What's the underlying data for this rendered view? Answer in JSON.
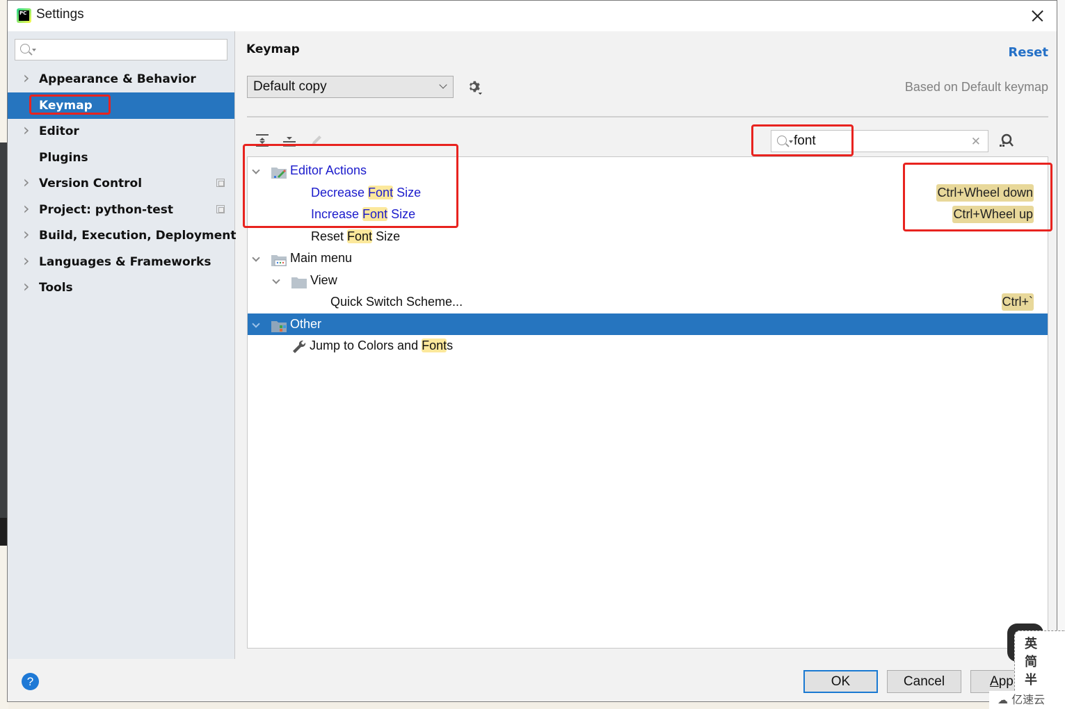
{
  "window": {
    "title": "Settings",
    "app_icon": "pycharm-icon",
    "close_icon": "close-icon"
  },
  "sidebar": {
    "search": {
      "value": "",
      "placeholder": ""
    },
    "items": [
      {
        "label": "Appearance & Behavior",
        "expandable": true,
        "selected": false,
        "project_icon": false
      },
      {
        "label": "Keymap",
        "expandable": false,
        "selected": true,
        "project_icon": false
      },
      {
        "label": "Editor",
        "expandable": true,
        "selected": false,
        "project_icon": false
      },
      {
        "label": "Plugins",
        "expandable": false,
        "selected": false,
        "project_icon": false
      },
      {
        "label": "Version Control",
        "expandable": true,
        "selected": false,
        "project_icon": true
      },
      {
        "label": "Project: python-test",
        "expandable": true,
        "selected": false,
        "project_icon": true
      },
      {
        "label": "Build, Execution, Deployment",
        "expandable": true,
        "selected": false,
        "project_icon": false
      },
      {
        "label": "Languages & Frameworks",
        "expandable": true,
        "selected": false,
        "project_icon": false
      },
      {
        "label": "Tools",
        "expandable": true,
        "selected": false,
        "project_icon": false
      }
    ]
  },
  "main": {
    "title": "Keymap",
    "reset_label": "Reset",
    "keymap_select": {
      "value": "Default copy"
    },
    "based_on": "Based on Default keymap",
    "toolbar": {
      "expand_all_icon": "expand-all-icon",
      "collapse_all_icon": "collapse-all-icon",
      "edit_icon": "pencil-icon"
    },
    "filter": {
      "value": "font",
      "placeholder": ""
    },
    "tree": [
      {
        "level": 0,
        "expanded": true,
        "icon": "editor-actions-folder-icon",
        "parts": [
          "Editor Actions"
        ],
        "highlight": [],
        "color": "blue",
        "shortcut": "",
        "selected": false
      },
      {
        "level": 2,
        "icon": "",
        "parts": [
          "Decrease ",
          "Font",
          " Size"
        ],
        "highlight": [
          1
        ],
        "color": "blue",
        "shortcut": "Ctrl+Wheel down",
        "selected": false
      },
      {
        "level": 2,
        "icon": "",
        "parts": [
          "Increase ",
          "Font",
          " Size"
        ],
        "highlight": [
          1
        ],
        "color": "blue",
        "shortcut": "Ctrl+Wheel up",
        "selected": false
      },
      {
        "level": 2,
        "icon": "",
        "parts": [
          "Reset ",
          "Font",
          " Size"
        ],
        "highlight": [
          1
        ],
        "color": "black",
        "shortcut": "",
        "selected": false
      },
      {
        "level": 0,
        "expanded": true,
        "icon": "main-menu-folder-icon",
        "parts": [
          "Main menu"
        ],
        "highlight": [],
        "color": "black",
        "shortcut": "",
        "selected": false
      },
      {
        "level": 1,
        "expanded": true,
        "icon": "folder-icon",
        "parts": [
          "View"
        ],
        "highlight": [],
        "color": "black",
        "shortcut": "",
        "selected": false
      },
      {
        "level": 3,
        "icon": "",
        "parts": [
          "Quick Switch Scheme..."
        ],
        "highlight": [],
        "color": "black",
        "shortcut": "Ctrl+`",
        "selected": false
      },
      {
        "level": 0,
        "expanded": true,
        "icon": "other-folder-icon",
        "parts": [
          "Other"
        ],
        "highlight": [],
        "color": "black",
        "shortcut": "",
        "selected": true
      },
      {
        "level": 2,
        "icon": "wrench-icon",
        "parts": [
          "Jump to Colors and ",
          "Font",
          "s"
        ],
        "highlight": [
          1
        ],
        "color": "black",
        "shortcut": "",
        "selected": false
      }
    ]
  },
  "footer": {
    "help_label": "?",
    "ok_label": "OK",
    "cancel_label": "Cancel",
    "apply_label_mnemonic": "A",
    "apply_label_rest": "pp"
  },
  "overlay": {
    "ime_chars": [
      "英",
      "简",
      "半"
    ],
    "watermark": "亿速云"
  },
  "colors": {
    "selection": "#2675bf",
    "link": "#2470c7",
    "match_highlight": "#fce89b",
    "shortcut_bg": "#e8d89a",
    "annotation_red": "#e8231f"
  }
}
